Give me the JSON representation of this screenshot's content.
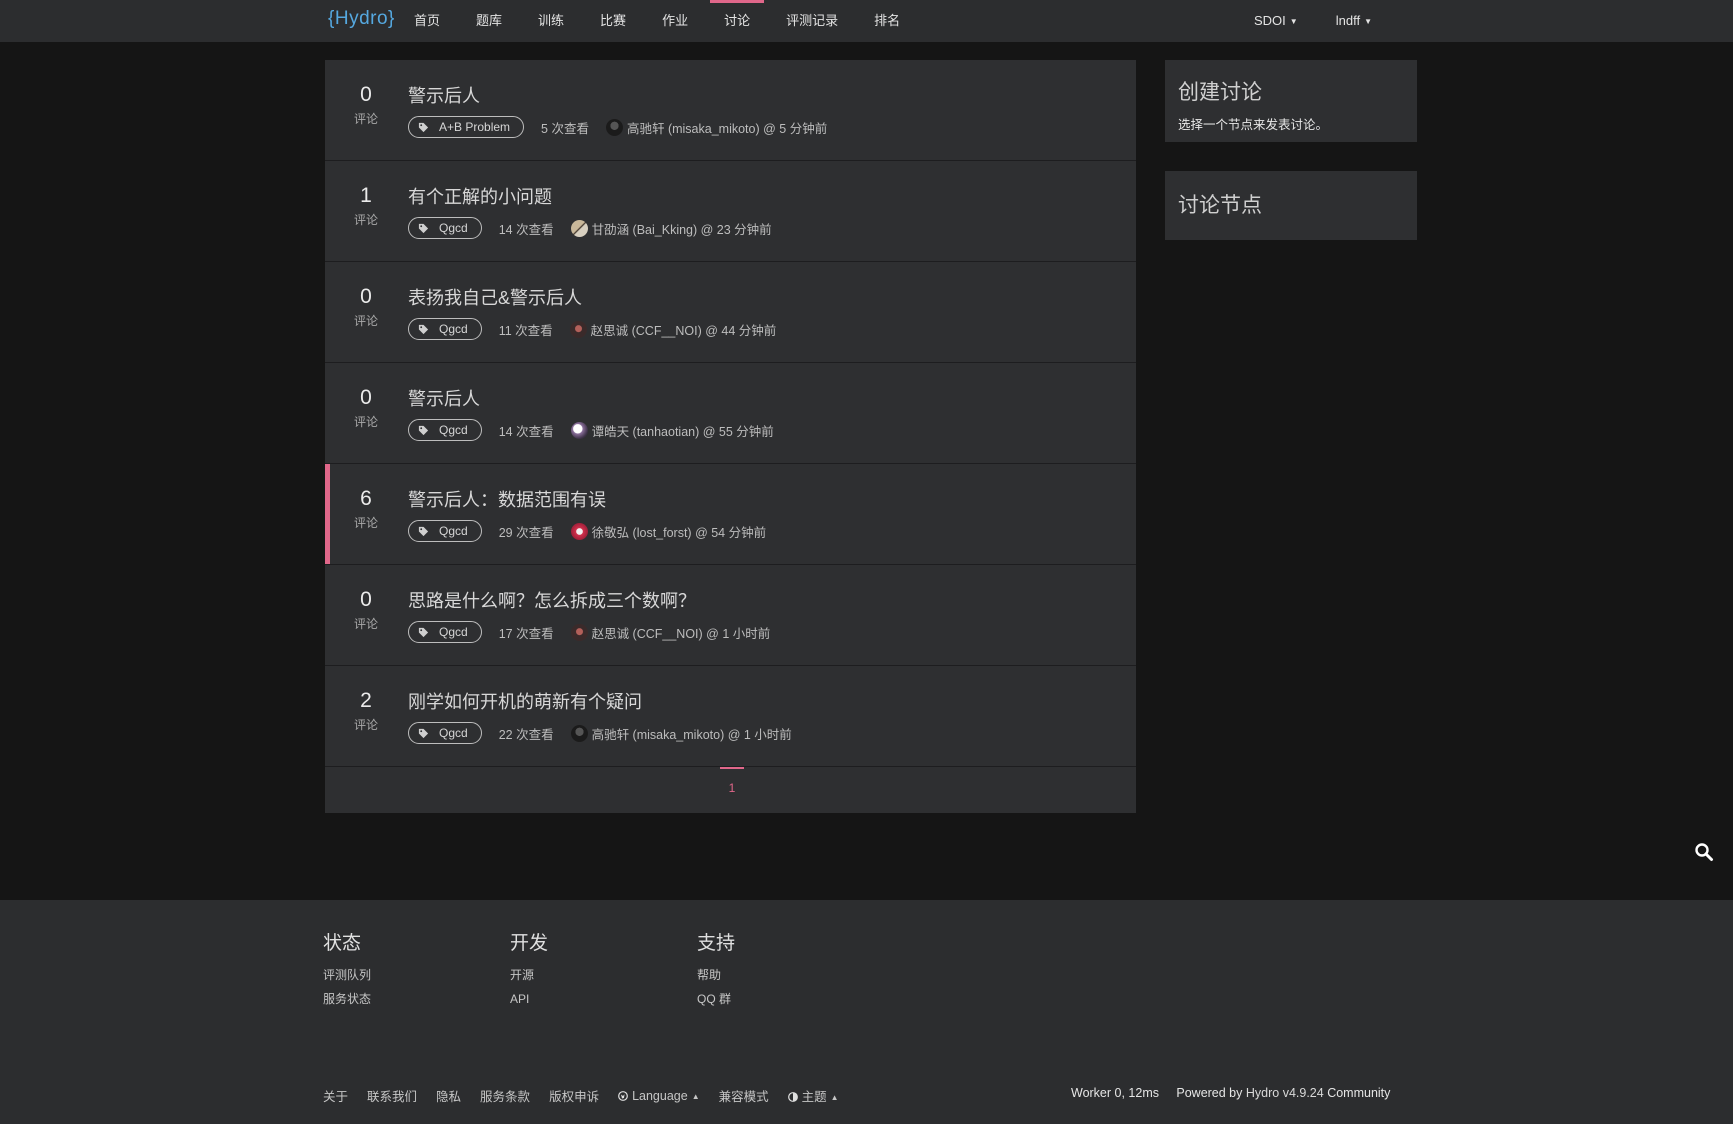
{
  "nav": {
    "logo": "{Hydro}",
    "items": [
      {
        "label": "首页"
      },
      {
        "label": "题库"
      },
      {
        "label": "训练"
      },
      {
        "label": "比赛"
      },
      {
        "label": "作业"
      },
      {
        "label": "讨论",
        "active": true
      },
      {
        "label": "评测记录"
      },
      {
        "label": "排名"
      }
    ],
    "domain": "SDOI",
    "user": "lndff",
    "caret": "▼"
  },
  "discussions": [
    {
      "count": "0",
      "count_label": "评论",
      "title": "警示后人",
      "tag": "A+B Problem",
      "views": "5 次查看",
      "user": "高驰轩 (misaka_mikoto) @ 5 分钟前"
    },
    {
      "count": "1",
      "count_label": "评论",
      "title": "有个正解的小问题",
      "tag": "Qgcd",
      "views": "14 次查看",
      "user": "甘劭涵 (Bai_Kking) @ 23 分钟前"
    },
    {
      "count": "0",
      "count_label": "评论",
      "title": "表扬我自己&警示后人",
      "tag": "Qgcd",
      "views": "11 次查看",
      "user": "赵思诚 (CCF__NOI) @ 44 分钟前"
    },
    {
      "count": "0",
      "count_label": "评论",
      "title": "警示后人",
      "tag": "Qgcd",
      "views": "14 次查看",
      "user": "谭皓天 (tanhaotian) @ 55 分钟前"
    },
    {
      "count": "6",
      "count_label": "评论",
      "title": "警示后人：数据范围有误",
      "tag": "Qgcd",
      "views": "29 次查看",
      "user": "徐敬弘 (lost_forst) @ 54 分钟前"
    },
    {
      "count": "0",
      "count_label": "评论",
      "title": "思路是什么啊？怎么拆成三个数啊？",
      "tag": "Qgcd",
      "views": "17 次查看",
      "user": "赵思诚 (CCF__NOI) @ 1 小时前"
    },
    {
      "count": "2",
      "count_label": "评论",
      "title": "刚学如何开机的萌新有个疑问",
      "tag": "Qgcd",
      "views": "22 次查看",
      "user": "高驰轩 (misaka_mikoto) @ 1 小时前"
    }
  ],
  "pagination": {
    "current": "1"
  },
  "sidebar": {
    "create_title": "创建讨论",
    "create_text": "选择一个节点来发表讨论。",
    "nodes_title": "讨论节点"
  },
  "footer": {
    "columns": [
      {
        "title": "状态",
        "links": [
          "评测队列",
          "服务状态"
        ]
      },
      {
        "title": "开发",
        "links": [
          "开源",
          "API"
        ]
      },
      {
        "title": "支持",
        "links": [
          "帮助",
          "QQ 群"
        ]
      }
    ],
    "bottom_links": [
      "关于",
      "联系我们",
      "隐私",
      "服务条款",
      "版权申诉"
    ],
    "language": "Language",
    "compat": "兼容模式",
    "theme": "主题",
    "up_caret": "▲",
    "worker": "Worker 0, 12ms",
    "powered_prefix": "Powered by",
    "powered_name": "Hydro v4.9.24",
    "powered_suffix": "Community"
  },
  "colors": {
    "accent": "#e0678a",
    "nav_bg": "#2c2d2f",
    "panel_bg": "#2e2f31",
    "page_bg": "#151515",
    "logo": "#55a8e0"
  }
}
